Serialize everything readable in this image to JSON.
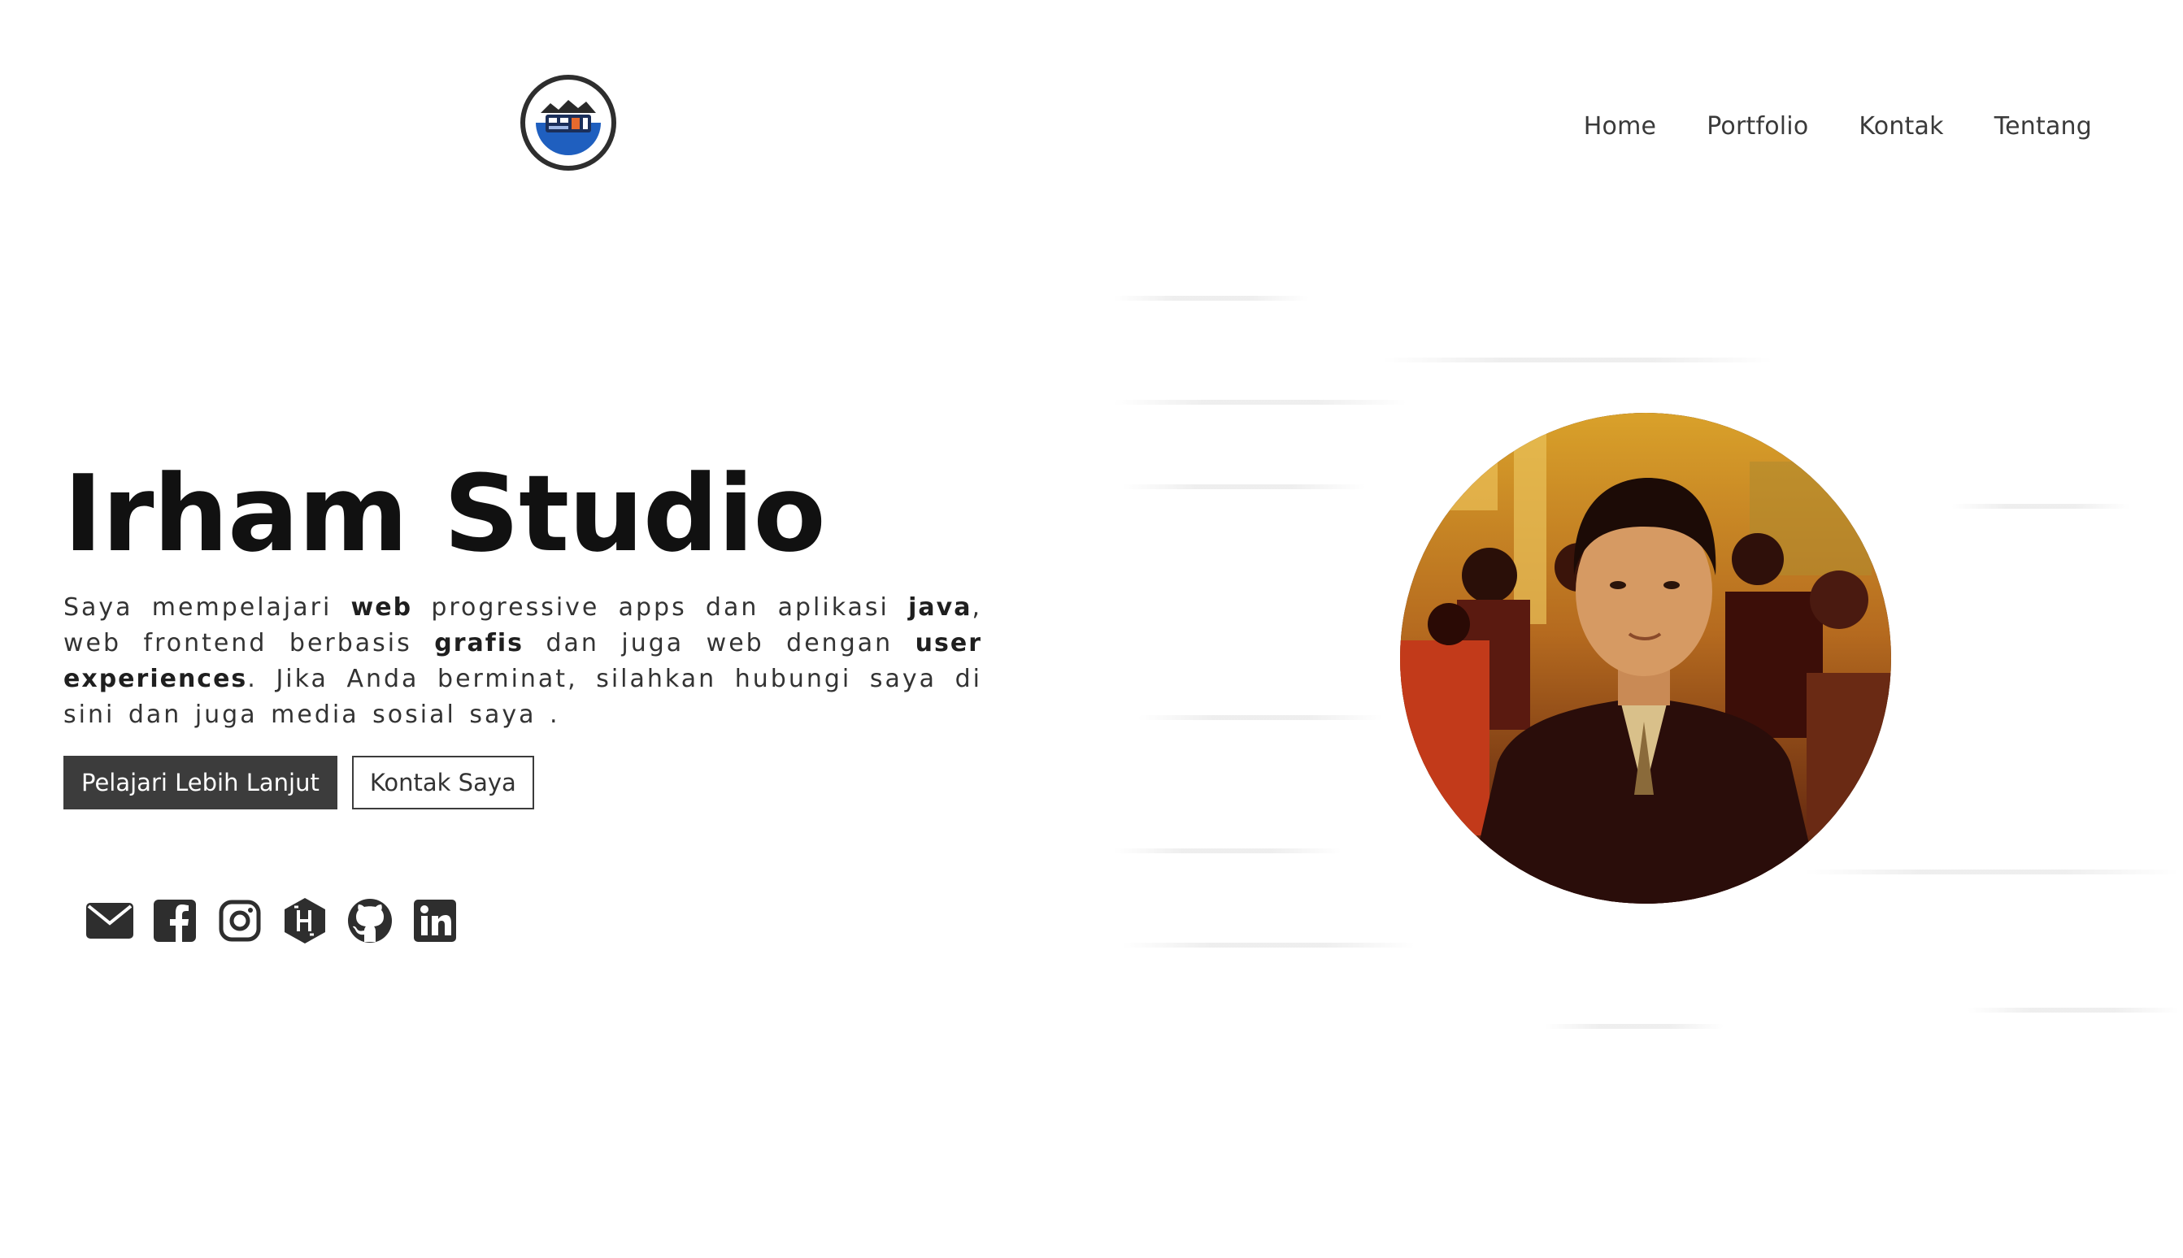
{
  "header": {
    "logo_icon": "studio-logo-icon",
    "nav": [
      {
        "label": "Home"
      },
      {
        "label": "Portfolio"
      },
      {
        "label": "Kontak"
      },
      {
        "label": "Tentang"
      }
    ]
  },
  "hero": {
    "title": "Irham Studio",
    "description": {
      "p1": "Saya mempelajari ",
      "b1": "web",
      "p2": " progressive apps dan aplikasi ",
      "b2": "java",
      "p3": ", web frontend berbasis ",
      "b3": "grafis",
      "p4": " dan juga web dengan ",
      "b4": "user experiences",
      "p5": ". Jika Anda berminat, silahkan hubungi saya di sini dan juga media sosial saya ."
    },
    "primary_button": "Pelajari Lebih Lanjut",
    "secondary_button": "Kontak Saya"
  },
  "social": [
    {
      "icon": "email-icon"
    },
    {
      "icon": "facebook-icon"
    },
    {
      "icon": "instagram-icon"
    },
    {
      "icon": "hashnode-icon"
    },
    {
      "icon": "github-icon"
    },
    {
      "icon": "linkedin-icon"
    }
  ],
  "portrait": {
    "icon": "profile-photo"
  },
  "colors": {
    "text_dark": "#111111",
    "button_dark": "#3c3c3c",
    "logo_blue": "#1f5fbf"
  }
}
